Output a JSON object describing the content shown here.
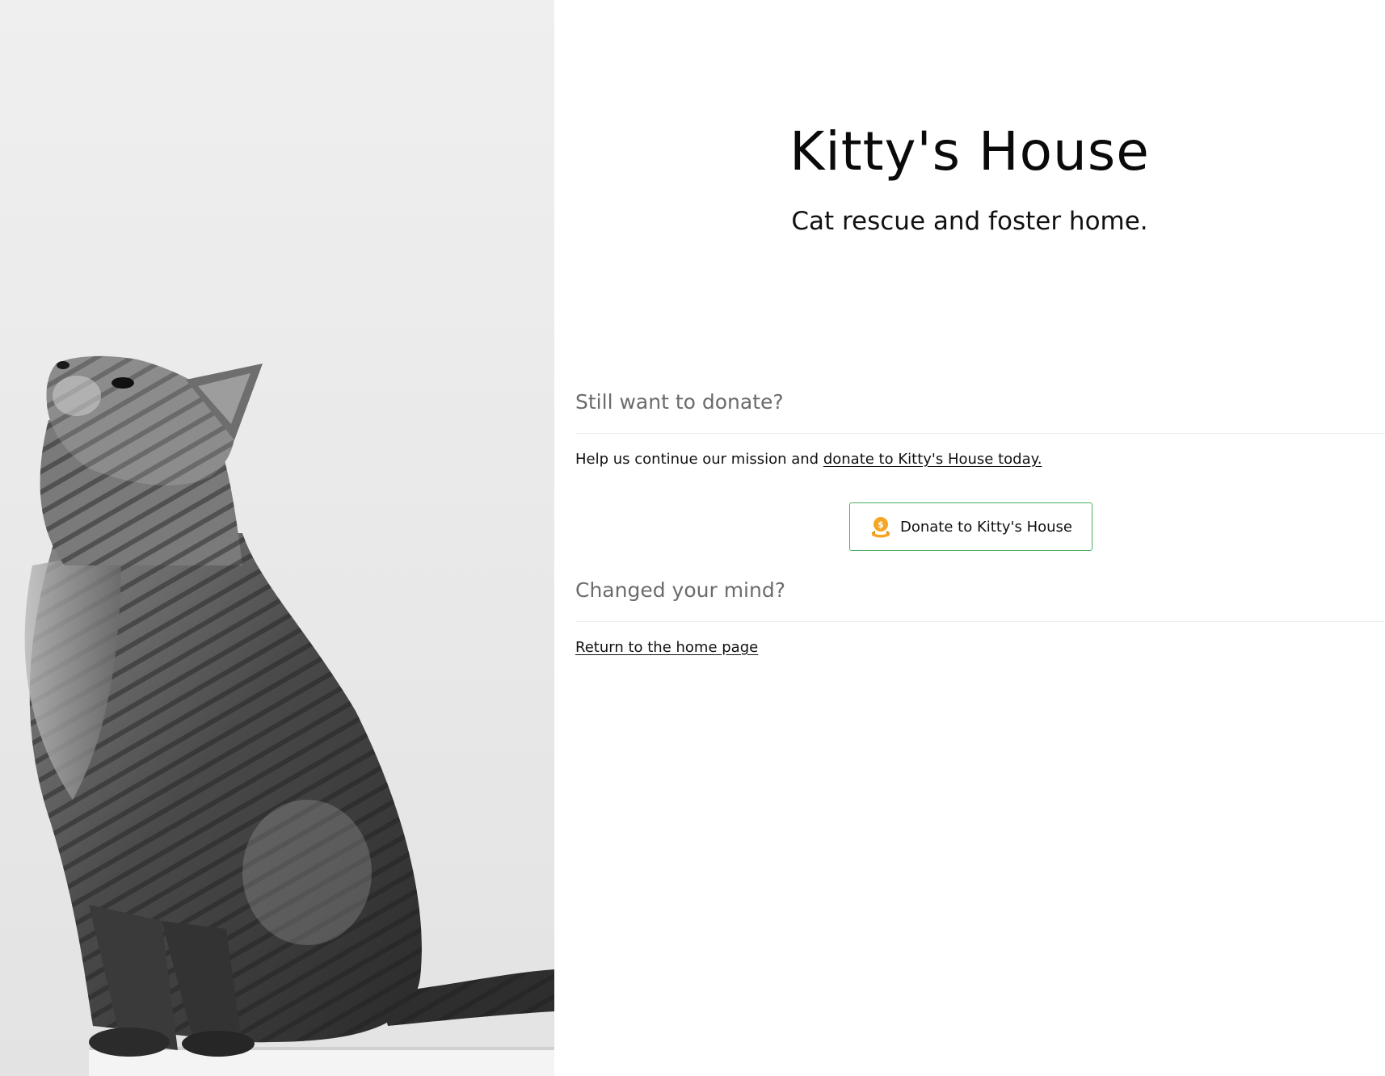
{
  "brand": {
    "title": "Kitty's House",
    "tagline": "Cat rescue and foster home."
  },
  "photo": {
    "alt": "Grayscale photo of a tabby cat sitting and looking upward"
  },
  "donate_section": {
    "heading": "Still want to donate?",
    "body_prefix": "Help us continue our mission and ",
    "body_link": "donate to Kitty's House today.",
    "button_label": "Donate to Kitty's House",
    "button_icon": "donation-coin-icon",
    "button_border_color": "#4caf62",
    "icon_color": "#f5a623"
  },
  "return_section": {
    "heading": "Changed your mind?",
    "link": "Return to the home page"
  }
}
